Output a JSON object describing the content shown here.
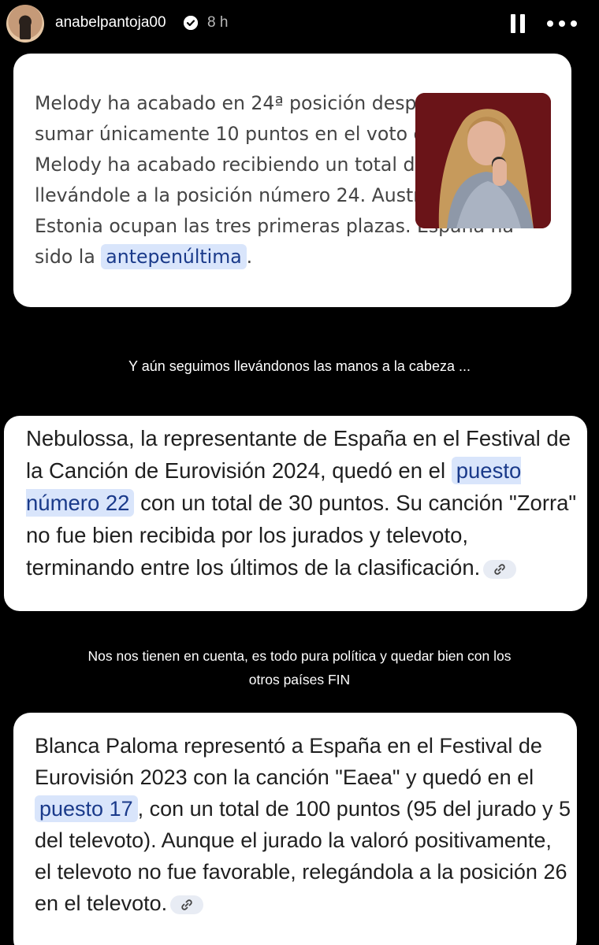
{
  "header": {
    "username": "anabelpantoja00",
    "time": "8 h"
  },
  "card1": {
    "text_before": "Melody ha acabado en 24ª posición después de sumar únicamente 10 puntos en el voto del público. Melody ha acabado recibiendo un total de 37 puntos, llevándole a la posición número 24. Austria, Israel y Estonia ocupan las tres primeras plazas. España ha sido la ",
    "highlight": "antepenúltima",
    "text_after": "."
  },
  "caption1": "Y aún seguimos llevándonos las manos a la cabeza ...",
  "card2": {
    "text_before": "Nebulossa, la representante de España en el Festival de la Canción de Eurovisión 2024, quedó en el ",
    "highlight": "puesto número 22",
    "text_after": " con un total de 30 puntos. Su canción \"Zorra\" no fue bien recibida por los jurados y televoto, terminando entre los últimos de la clasificación."
  },
  "caption2_line1": "Nos nos tienen en cuenta, es todo pura política y quedar bien con los",
  "caption2_line2": "otros países FIN",
  "card3": {
    "text_before": "Blanca Paloma representó a España en el Festival de Eurovisión 2023 con la canción \"Eaea\" y quedó en el ",
    "highlight": "puesto 17",
    "text_after": ", con un total de 100 puntos (95 del jurado y 5 del televoto). Aunque el jurado la valoró positivamente, el televoto no fue favorable, relegándola a la posición 26 en el televoto."
  },
  "icons": {
    "verified": "verified-badge-icon",
    "pause": "pause-icon",
    "more": "more-options-icon",
    "link": "link-icon"
  },
  "colors": {
    "background": "#000000",
    "card": "#ffffff",
    "highlight_bg": "#d9e5fb",
    "highlight_text": "#1a3a8a"
  }
}
